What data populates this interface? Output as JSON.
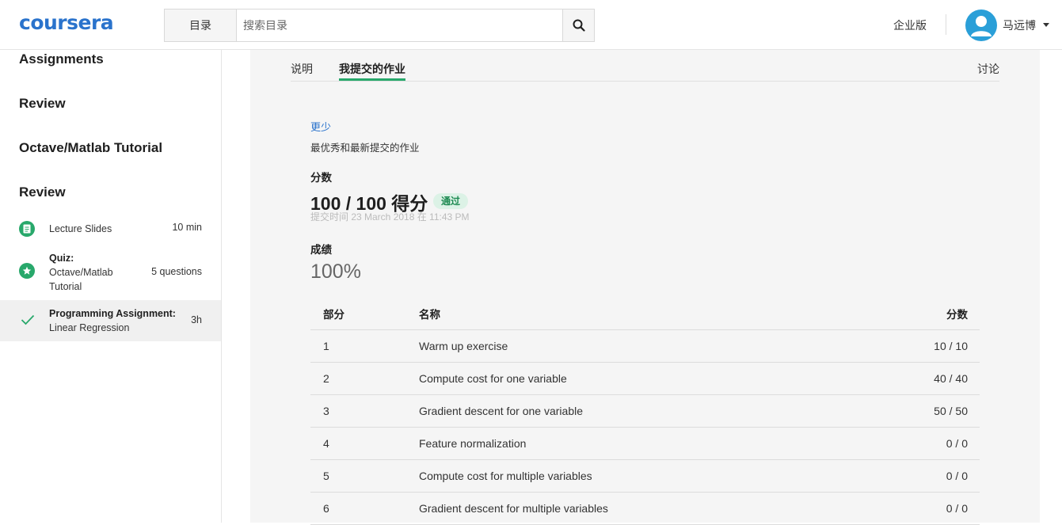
{
  "header": {
    "logo": "coursera",
    "catalog_label": "目录",
    "search_placeholder": "搜索目录",
    "search_icon": "search-icon",
    "enterprise_label": "企业版",
    "user_name": "马远博"
  },
  "sidebar": {
    "sections": [
      "Assignments",
      "Review",
      "Octave/Matlab Tutorial",
      "Review"
    ],
    "items": [
      {
        "type": "reading",
        "icon": "lecture-slides-icon",
        "title": "",
        "label": "Lecture Slides",
        "duration": "10 min"
      },
      {
        "type": "quiz",
        "icon": "star-icon",
        "title": "Quiz:",
        "label": "Octave/Matlab Tutorial",
        "duration": "5 questions"
      },
      {
        "type": "programming",
        "icon": "check-icon",
        "title": "Programming Assignment:",
        "label": "Linear Regression",
        "duration": "3h"
      }
    ]
  },
  "tabs": {
    "instructions": "说明",
    "my_submission": "我提交的作业",
    "discussions": "讨论"
  },
  "submission": {
    "less_link": "更少",
    "subtitle": "最优秀和最新提交的作业",
    "score_label": "分数",
    "score_text": "100 / 100 得分",
    "pass_badge": "通过",
    "submitted_text": "提交时间 23 March 2018 在 11:43 PM",
    "grade_label": "成绩",
    "grade_value": "100%"
  },
  "table": {
    "headers": [
      "部分",
      "名称",
      "分数"
    ],
    "rows": [
      [
        "1",
        "Warm up exercise",
        "10 / 10"
      ],
      [
        "2",
        "Compute cost for one variable",
        "40 / 40"
      ],
      [
        "3",
        "Gradient descent for one variable",
        "50 / 50"
      ],
      [
        "4",
        "Feature normalization",
        "0 / 0"
      ],
      [
        "5",
        "Compute cost for multiple variables",
        "0 / 0"
      ],
      [
        "6",
        "Gradient descent for multiple variables",
        "0 / 0"
      ]
    ]
  },
  "colors": {
    "brand": "#2a73cc",
    "accent_green": "#28a86b",
    "avatar_bg": "#2a9fd8"
  }
}
